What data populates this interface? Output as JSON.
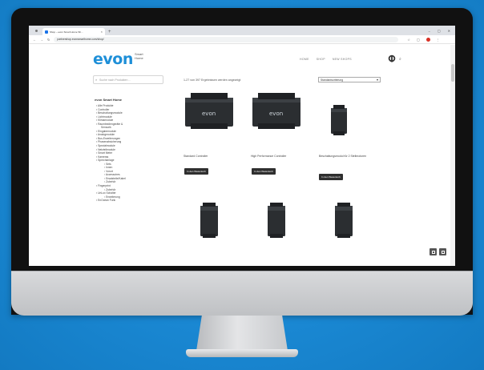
{
  "browser": {
    "tab_title": "Shop – evon Smart Home Sh...",
    "tab_close": "×",
    "new_tab": "+",
    "url": "partnershop.evonsmarthome.com/shop/",
    "win_min": "–",
    "win_max": "▢",
    "win_close": "✕"
  },
  "header": {
    "logo": "evon",
    "logo_sub_1": "Smart",
    "logo_sub_2": "Home",
    "nav": [
      "HOME",
      "SHOP",
      "NEW SHOPS"
    ]
  },
  "sidebar": {
    "search_placeholder": "Suche nach Produkten ...",
    "category_title": "evon Smart Home",
    "categories": [
      {
        "label": "Alle Produkte",
        "level": 1
      },
      {
        "label": "Controller",
        "level": 1
      },
      {
        "label": "Beschaltungsmodule",
        "level": 1
      },
      {
        "label": "Lichtmodule",
        "level": 1
      },
      {
        "label": "Klimamodule",
        "level": 1
      },
      {
        "label": "Raumbediengeräte &",
        "level": 1
      },
      {
        "label": "Sensorik",
        "level": 0
      },
      {
        "label": "Eingabemodule",
        "level": 1
      },
      {
        "label": "Analogmodule",
        "level": 1
      },
      {
        "label": "Bus-Erweiterungen",
        "level": 1
      },
      {
        "label": "Phasenabsicherung",
        "level": 1
      },
      {
        "label": "Spezialmodule",
        "level": 1
      },
      {
        "label": "Netzteilmodule",
        "level": 1
      },
      {
        "label": "Smart Meter",
        "level": 1
      },
      {
        "label": "Kameras",
        "level": 1
      },
      {
        "label": "Sprechanlage",
        "level": 1
      },
      {
        "label": "Sets",
        "level": 2
      },
      {
        "label": "Innen",
        "level": 2
      },
      {
        "label": "Vorort",
        "level": 2
      },
      {
        "label": "Accessoires",
        "level": 2
      },
      {
        "label": "Ersatzteile/Kabel",
        "level": 2
      },
      {
        "label": "Zubehör",
        "level": 2
      },
      {
        "label": "Fingerprint",
        "level": 1
      },
      {
        "label": "Zubehör",
        "level": 2
      },
      {
        "label": "UnLux Schalter",
        "level": 1
      },
      {
        "label": "Erweiterung",
        "level": 2
      },
      {
        "label": "EnOcean Funk",
        "level": 1
      }
    ]
  },
  "main": {
    "result_count": "1-27 von 397 Ergebnissen werden angezeigt",
    "sort_label": "Standardsortierung",
    "add_to_cart": "In den Warenkorb",
    "products": [
      {
        "name": "Standard Controller"
      },
      {
        "name": "High Performance Controller"
      },
      {
        "name": "Beschaltungsmodul für 2 Stellmotoren"
      },
      {
        "name": ""
      },
      {
        "name": ""
      },
      {
        "name": ""
      }
    ]
  },
  "colors": {
    "brand": "#1e8fd8",
    "background": "#1a8ad6",
    "button": "#2f2f2f"
  }
}
